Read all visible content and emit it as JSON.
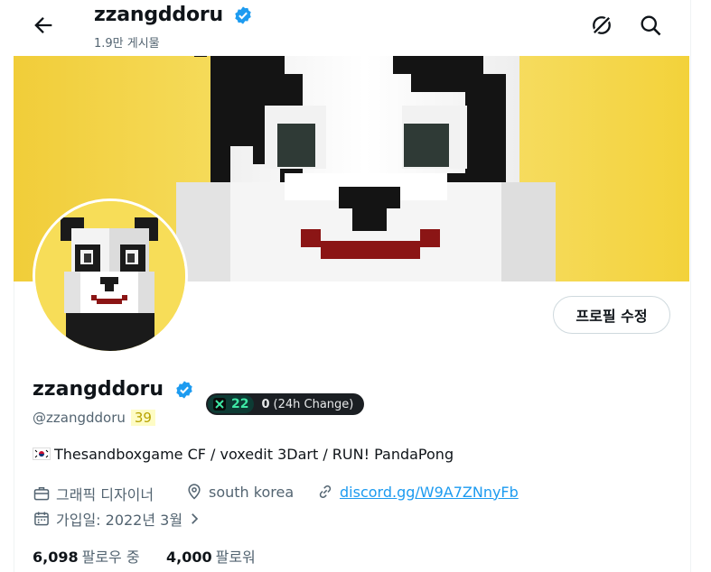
{
  "header": {
    "name": "zzangddoru",
    "post_count": "1.9만 게시물",
    "icons": [
      "back-arrow-icon",
      "verified-badge-icon",
      "cycle-icon",
      "search-icon"
    ]
  },
  "profile": {
    "edit_button": "프로필 수정",
    "display_name": "zzangddoru",
    "handle": "@zzangddoru",
    "handle_badge": "39",
    "score_value": "22",
    "score_change": "0",
    "score_change_label": "(24h Change)",
    "bio": "Thesandboxgame CF / voxedit 3Dart / RUN! PandaPong",
    "occupation": "그래픽 디자이너",
    "location": "south korea",
    "website": "discord.gg/W9A7ZNnyFb",
    "joined": "가입일: 2022년 3월",
    "following_count": "6,098",
    "following_label": "팔로우 중",
    "followers_count": "4,000",
    "followers_label": "팔로워"
  },
  "colors": {
    "accent": "#1d9bf0",
    "banner": "#f3d23a",
    "score_green": "#3ee8a5"
  }
}
